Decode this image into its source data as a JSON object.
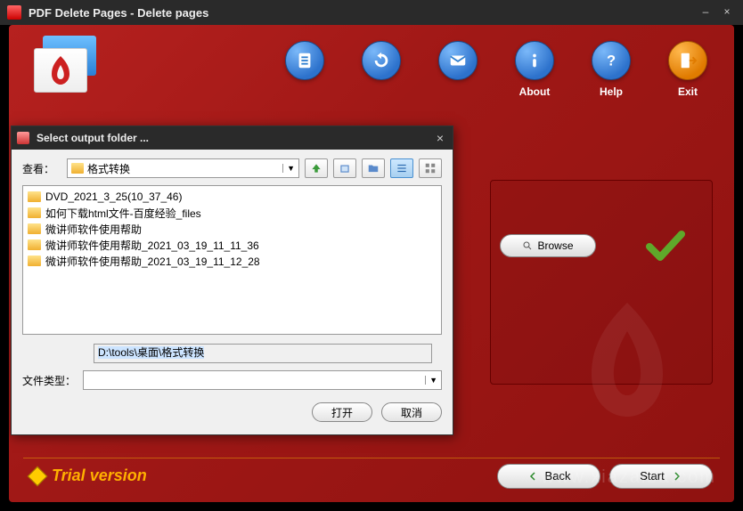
{
  "window": {
    "title": "PDF Delete Pages - Delete pages",
    "minimize": "–",
    "close": "×"
  },
  "toolbar": [
    {
      "label": "",
      "icon": "doc"
    },
    {
      "label": "",
      "icon": "refresh"
    },
    {
      "label": "",
      "icon": "mail"
    },
    {
      "label": "About",
      "icon": "info"
    },
    {
      "label": "Help",
      "icon": "help"
    },
    {
      "label": "Exit",
      "icon": "exit",
      "style": "orange"
    }
  ],
  "browse": {
    "label": "Browse"
  },
  "trial": {
    "label": "Trial version"
  },
  "nav": {
    "back": "Back",
    "start": "Start"
  },
  "watermark": "www.xiazaiba.com",
  "dialog": {
    "title": "Select output folder ...",
    "close": "×",
    "look_label": "查看：",
    "current_folder": "格式转换",
    "files": [
      "DVD_2021_3_25(10_37_46)",
      "如何下载html文件-百度经验_files",
      "微讲师软件使用帮助",
      "微讲师软件使用帮助_2021_03_19_11_11_36",
      "微讲师软件使用帮助_2021_03_19_11_12_28"
    ],
    "path_value": "D:\\tools\\桌面\\格式转换",
    "type_label": "文件类型：",
    "type_value": "",
    "open": "打开",
    "cancel": "取消"
  }
}
